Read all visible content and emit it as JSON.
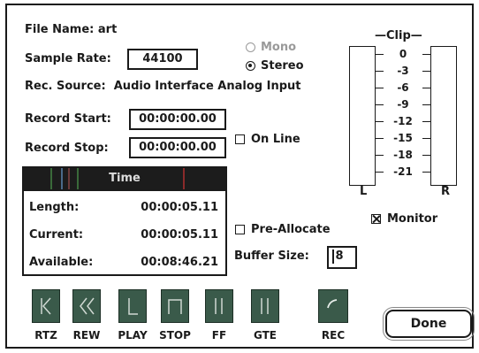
{
  "file": {
    "label": "File Name:",
    "value": "art"
  },
  "sample_rate": {
    "label": "Sample Rate:",
    "value": "44100"
  },
  "channels": {
    "mono": {
      "label": "Mono",
      "selected": false
    },
    "stereo": {
      "label": "Stereo",
      "selected": true
    }
  },
  "rec_source": {
    "label": "Rec. Source:",
    "value": "Audio Interface Analog Input"
  },
  "record_start": {
    "label": "Record Start:",
    "value": "00:00:00.00"
  },
  "record_stop": {
    "label": "Record Stop:",
    "value": "00:00:00.00"
  },
  "on_line": {
    "label": "On Line",
    "checked": false
  },
  "time_panel": {
    "title": "Time",
    "rows": [
      {
        "label": "Length:",
        "value": "00:00:05.11"
      },
      {
        "label": "Current:",
        "value": "00:00:05.11"
      },
      {
        "label": "Available:",
        "value": "00:08:46.21"
      }
    ]
  },
  "meter": {
    "title": "Clip",
    "ticks": [
      "0",
      "-3",
      "-6",
      "-9",
      "-12",
      "-15",
      "-18",
      "-21"
    ],
    "left_label": "L",
    "right_label": "R"
  },
  "pre_allocate": {
    "label": "Pre-Allocate",
    "checked": false
  },
  "monitor": {
    "label": "Monitor",
    "checked": true
  },
  "buffer_size": {
    "label": "Buffer Size:",
    "value": "8"
  },
  "transport": [
    {
      "label": "RTZ",
      "icon": "return-to-zero-icon"
    },
    {
      "label": "REW",
      "icon": "rewind-icon"
    },
    {
      "label": "PLAY",
      "icon": "play-icon"
    },
    {
      "label": "STOP",
      "icon": "stop-icon"
    },
    {
      "label": "FF",
      "icon": "fast-forward-icon"
    },
    {
      "label": "GTE",
      "icon": "go-to-end-icon"
    },
    {
      "label": "REC",
      "icon": "record-icon"
    }
  ],
  "done_label": "Done",
  "colors": {
    "transport_button": "#3a5a4a",
    "time_header": "#1c1c1c"
  }
}
